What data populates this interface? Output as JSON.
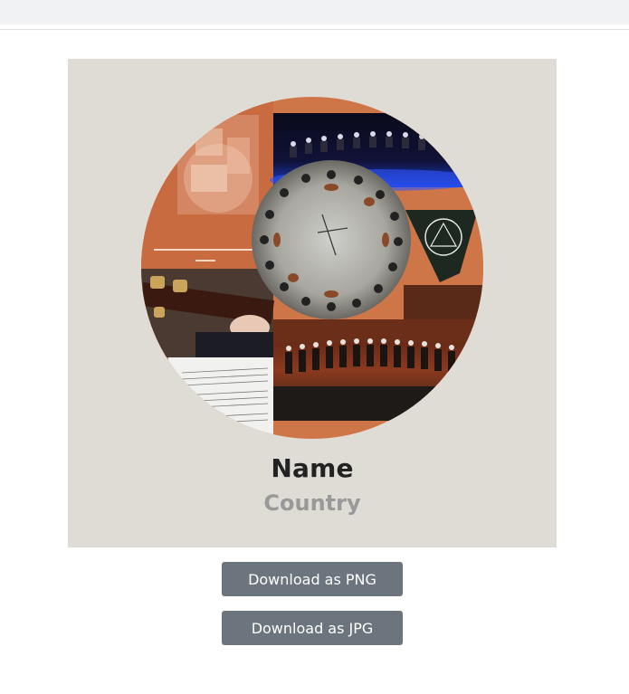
{
  "profile": {
    "name": "Name",
    "country": "Country"
  },
  "collage": {
    "tiles": [
      "album-cover-tile",
      "stage-concert-tile",
      "guitar-circle-tile",
      "emblem-tile",
      "guitar-hands-tile",
      "sheet-music-tile",
      "orchestra-stage-tile"
    ]
  },
  "actions": {
    "download_png_label": "Download as PNG",
    "download_jpg_label": "Download as JPG"
  },
  "colors": {
    "card_background": "#dfdcd5",
    "accent_orange": "#cf7649",
    "button_gray": "#6c757d",
    "country_gray": "#999999"
  }
}
